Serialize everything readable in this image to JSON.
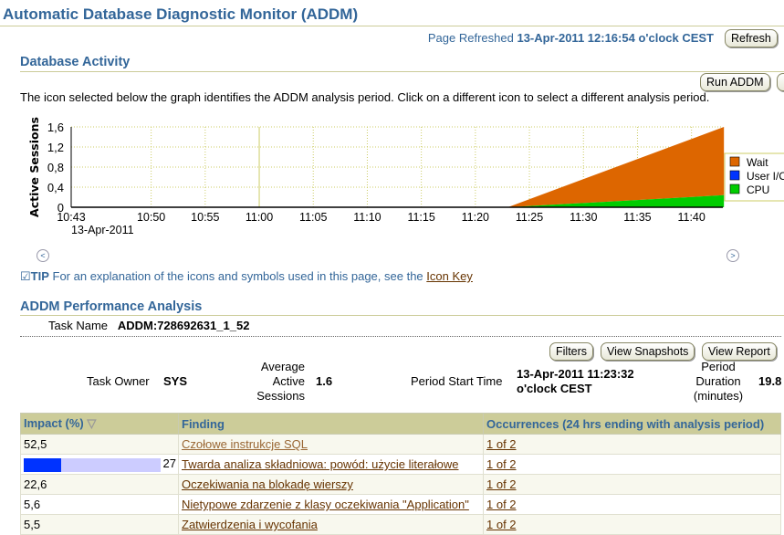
{
  "header": {
    "title": "Automatic Database Diagnostic Monitor (ADDM)",
    "refreshed_label": "Page Refreshed",
    "refreshed_value": "13-Apr-2011 12:16:54 o'clock CEST",
    "refresh_button": "Refresh"
  },
  "activity": {
    "title": "Database Activity",
    "run_addm_button": "Run ADDM",
    "instructions": "The icon selected below the graph identifies the ADDM analysis period. Click on a different icon to select a different analysis period.",
    "tip_label": "TIP",
    "tip_text": "For an explanation of the icons and symbols used in this page, see the",
    "icon_key_link": "Icon Key"
  },
  "chart_data": {
    "type": "area",
    "ylabel": "Active Sessions",
    "ylim": [
      0,
      1.6
    ],
    "yticks": [
      "0",
      "0,4",
      "0,8",
      "1,2",
      "1,6"
    ],
    "xticks": [
      "10:43",
      "10:50",
      "10:55",
      "11:00",
      "11:05",
      "11:10",
      "11:15",
      "11:20",
      "11:25",
      "11:30",
      "11:35",
      "11:40"
    ],
    "xdate": "13-Apr-2011",
    "grid": true,
    "legend_placement": "right",
    "selected_time": "11:00",
    "x": [
      "11:23",
      "11:43"
    ],
    "series": [
      {
        "name": "Wait",
        "color": "#dd6600",
        "values": [
          0,
          1.36
        ]
      },
      {
        "name": "User I/O",
        "color": "#0033ff",
        "values": [
          0,
          0
        ]
      },
      {
        "name": "CPU",
        "color": "#00cc00",
        "values": [
          0,
          0.24
        ]
      }
    ]
  },
  "analysis": {
    "title": "ADDM Performance Analysis",
    "task_name_label": "Task Name",
    "task_name": "ADDM:728692631_1_52",
    "filters_button": "Filters",
    "snapshots_button": "View Snapshots",
    "report_button": "View Report",
    "task_owner_label": "Task Owner",
    "task_owner": "SYS",
    "aas_label": "Average Active Sessions",
    "aas": "1.6",
    "period_start_label": "Period Start Time",
    "period_start": "13-Apr-2011 11:23:32 o'clock CEST",
    "duration_label": "Period Duration (minutes)",
    "duration": "19.8"
  },
  "table": {
    "headers": [
      "Impact (%)",
      "Finding",
      "Occurrences (24 hrs ending with analysis period)"
    ],
    "rows": [
      {
        "impact": "52,5",
        "finding": "Czołowe instrukcje SQL",
        "occ": "1 of 2"
      },
      {
        "impact": "27",
        "bar_percent": 27,
        "finding": "Twarda analiza składniowa: powód: użycie literałowe",
        "occ": "1 of 2"
      },
      {
        "impact": "22,6",
        "finding": "Oczekiwania na blokadę wierszy",
        "occ": "1 of 2"
      },
      {
        "impact": "5,6",
        "finding": "Nietypowe zdarzenie z klasy oczekiwania \"Application\"",
        "occ": "1 of 2"
      },
      {
        "impact": "5,5",
        "finding": "Zatwierdzenia i wycofania",
        "occ": "1 of 2"
      }
    ]
  }
}
